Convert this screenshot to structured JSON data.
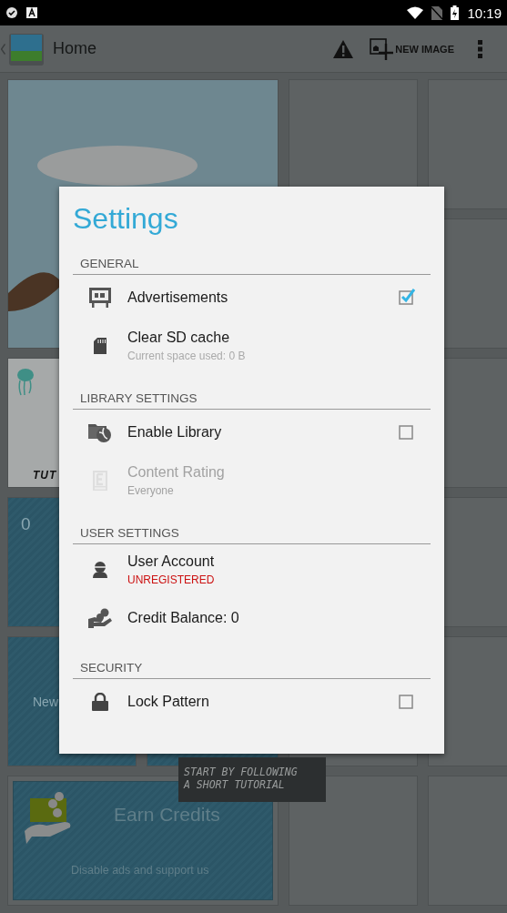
{
  "status_bar": {
    "time": "10:19"
  },
  "action_bar": {
    "title": "Home",
    "action": "NEW IMAGE"
  },
  "home_tiles": {
    "tutorial_label": "TUT",
    "count": "0",
    "new_label": "New",
    "earn_title": "Earn Credits",
    "earn_subtitle": "Disable ads and support us"
  },
  "tooltip": "START BY FOLLOWING\nA SHORT TUTORIAL",
  "dialog": {
    "title": "Settings",
    "sections": [
      {
        "header": "GENERAL",
        "items": [
          {
            "kind": "checkbox",
            "title": "Advertisements",
            "checked": true,
            "disabled": false
          },
          {
            "kind": "plain",
            "title": "Clear SD cache",
            "subtitle": "Current space used: 0 B",
            "disabled": false,
            "alert": false
          }
        ]
      },
      {
        "header": "LIBRARY SETTINGS",
        "items": [
          {
            "kind": "checkbox",
            "title": "Enable Library",
            "checked": false,
            "disabled": false
          },
          {
            "kind": "plain",
            "title": "Content Rating",
            "subtitle": "Everyone",
            "disabled": true,
            "alert": false
          }
        ]
      },
      {
        "header": "USER SETTINGS",
        "items": [
          {
            "kind": "plain",
            "title": "User Account",
            "subtitle": "UNREGISTERED",
            "disabled": false,
            "alert": true
          },
          {
            "kind": "plain",
            "title": "Credit Balance: 0",
            "disabled": false
          }
        ]
      },
      {
        "header": "SECURITY",
        "items": [
          {
            "kind": "checkbox",
            "title": "Lock Pattern",
            "checked": false,
            "disabled": false
          }
        ]
      }
    ]
  }
}
